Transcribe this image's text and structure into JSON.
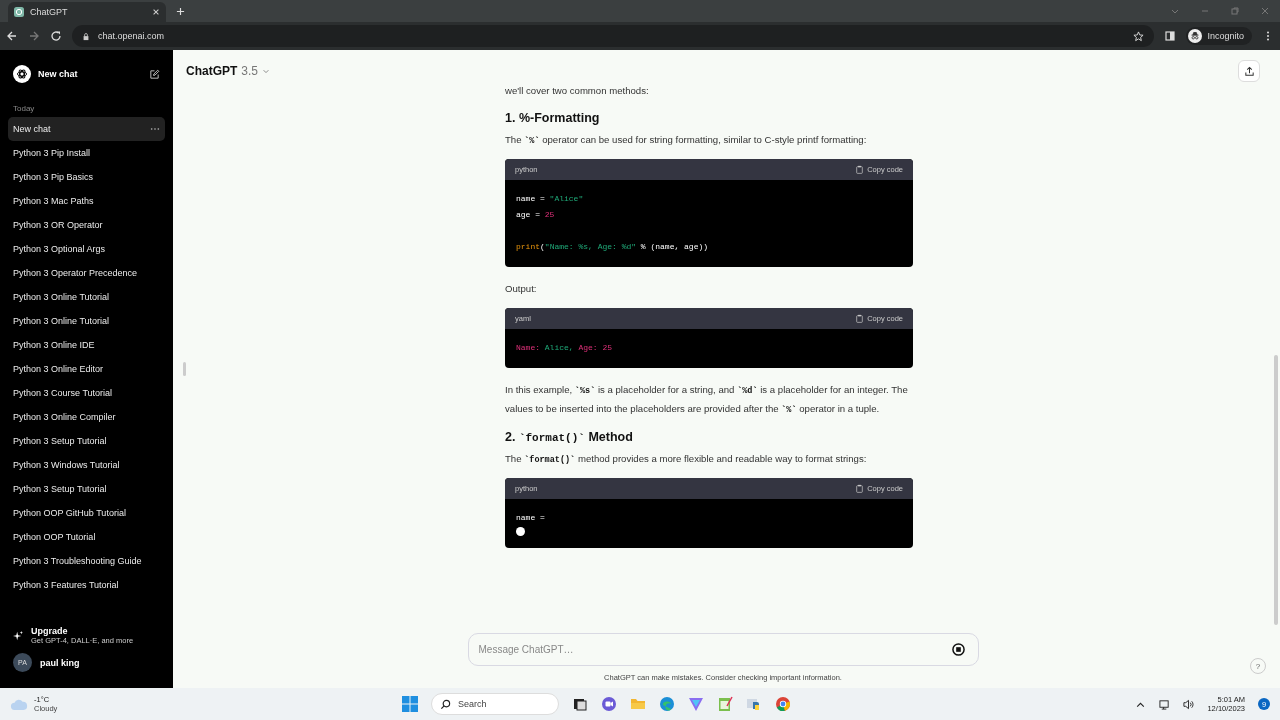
{
  "browser": {
    "tab_title": "ChatGPT",
    "url": "chat.openai.com",
    "profile": "Incognito"
  },
  "sidebar": {
    "new_chat": "New chat",
    "section": "Today",
    "items": [
      {
        "label": "New chat",
        "selected": true
      },
      {
        "label": "Python 3 Pip Install",
        "selected": false
      },
      {
        "label": "Python 3 Pip Basics",
        "selected": false
      },
      {
        "label": "Python 3 Mac Paths",
        "selected": false
      },
      {
        "label": "Python 3 OR Operator",
        "selected": false
      },
      {
        "label": "Python 3 Optional Args",
        "selected": false
      },
      {
        "label": "Python 3 Operator Precedence",
        "selected": false
      },
      {
        "label": "Python 3 Online Tutorial",
        "selected": false
      },
      {
        "label": "Python 3 Online Tutorial",
        "selected": false
      },
      {
        "label": "Python 3 Online IDE",
        "selected": false
      },
      {
        "label": "Python 3 Online Editor",
        "selected": false
      },
      {
        "label": "Python 3 Course Tutorial",
        "selected": false
      },
      {
        "label": "Python 3 Online Compiler",
        "selected": false
      },
      {
        "label": "Python 3 Setup Tutorial",
        "selected": false
      },
      {
        "label": "Python 3 Windows Tutorial",
        "selected": false
      },
      {
        "label": "Python 3 Setup Tutorial",
        "selected": false
      },
      {
        "label": "Python OOP GitHub Tutorial",
        "selected": false
      },
      {
        "label": "Python OOP Tutorial",
        "selected": false
      },
      {
        "label": "Python 3 Troubleshooting Guide",
        "selected": false
      },
      {
        "label": "Python 3 Features Tutorial",
        "selected": false
      }
    ],
    "upgrade": {
      "title": "Upgrade",
      "subtitle": "Get GPT-4, DALL·E, and more"
    },
    "user": {
      "initials": "PA",
      "name": "paul king"
    }
  },
  "header": {
    "model": "ChatGPT",
    "version": "3.5"
  },
  "content": [
    {
      "kind": "para",
      "parts": [
        {
          "kind": "text",
          "text": "we'll cover two common methods:"
        }
      ]
    },
    {
      "kind": "heading",
      "parts": [
        {
          "kind": "text",
          "text": "1. %-Formatting"
        }
      ]
    },
    {
      "kind": "para",
      "parts": [
        {
          "kind": "text",
          "text": "The "
        },
        {
          "kind": "code",
          "text": "`%`"
        },
        {
          "kind": "text",
          "text": " operator can be used for string formatting, similar to C-style printf formatting:"
        }
      ]
    },
    {
      "kind": "code",
      "language": "python",
      "copy": "Copy code",
      "lines": [
        {
          "tokens": [
            {
              "kind": "plain",
              "text": "name = "
            },
            {
              "kind": "string",
              "text": "\"Alice\""
            }
          ]
        },
        {
          "tokens": [
            {
              "kind": "plain",
              "text": "age = "
            },
            {
              "kind": "number",
              "text": "25"
            }
          ]
        },
        {
          "blank_before": true,
          "tokens": [
            {
              "kind": "func",
              "text": "print"
            },
            {
              "kind": "plain",
              "text": "("
            },
            {
              "kind": "string",
              "text": "\"Name: %s, Age: %d\""
            },
            {
              "kind": "plain",
              "text": " % (name, age))"
            }
          ]
        }
      ]
    },
    {
      "kind": "para",
      "parts": [
        {
          "kind": "text",
          "text": "Output:"
        }
      ]
    },
    {
      "kind": "code",
      "language": "yaml",
      "copy": "Copy code",
      "lines": [
        {
          "tokens": [
            {
              "kind": "number",
              "text": "Name: "
            },
            {
              "kind": "string",
              "text": "Alice, "
            },
            {
              "kind": "number",
              "text": "Age: 25"
            }
          ]
        }
      ]
    },
    {
      "kind": "para",
      "parts": [
        {
          "kind": "text",
          "text": "In this example, "
        },
        {
          "kind": "code",
          "text": "`%s`"
        },
        {
          "kind": "text",
          "text": " is a placeholder for a string, and "
        },
        {
          "kind": "code",
          "text": "`%d`"
        },
        {
          "kind": "text",
          "text": " is a placeholder for an integer. The values to be inserted into the placeholders are provided after the "
        },
        {
          "kind": "code",
          "text": "`%`"
        },
        {
          "kind": "text",
          "text": " operator in a tuple."
        }
      ]
    },
    {
      "kind": "heading",
      "parts": [
        {
          "kind": "text",
          "text": "2. "
        },
        {
          "kind": "code",
          "text": "`format()`"
        },
        {
          "kind": "text",
          "text": " Method"
        }
      ]
    },
    {
      "kind": "para",
      "parts": [
        {
          "kind": "text",
          "text": "The "
        },
        {
          "kind": "code",
          "text": "`format()`"
        },
        {
          "kind": "text",
          "text": " method provides a more flexible and readable way to format strings:"
        }
      ]
    },
    {
      "kind": "code",
      "language": "python",
      "copy": "Copy code",
      "streaming": true,
      "lines": [
        {
          "tokens": [
            {
              "kind": "plain",
              "text": "name ="
            }
          ]
        }
      ]
    }
  ],
  "composer": {
    "placeholder": "Message ChatGPT…",
    "disclaimer": "ChatGPT can make mistakes. Consider checking important information.",
    "help": "?"
  },
  "taskbar": {
    "weather": {
      "temp": "-1°C",
      "condition": "Cloudy"
    },
    "search": "Search",
    "time": "5:01 AM",
    "date": "12/10/2023",
    "badge": "9"
  }
}
